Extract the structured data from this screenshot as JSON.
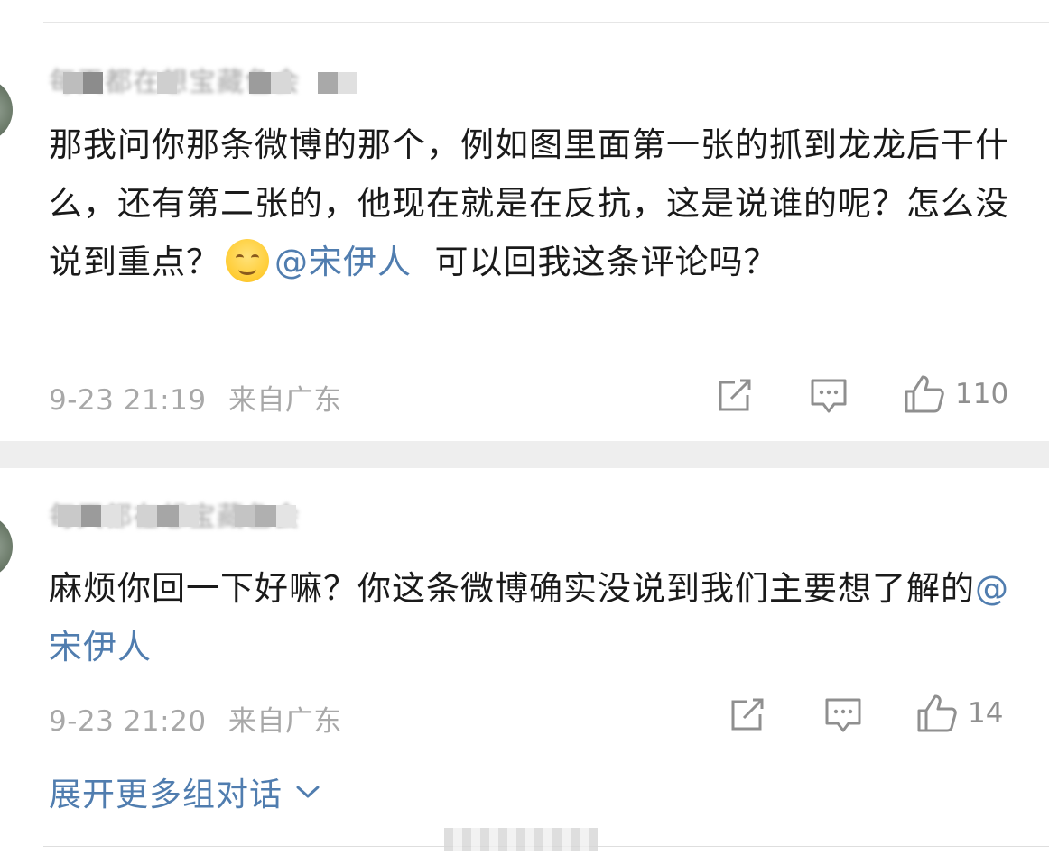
{
  "comments": [
    {
      "username": "每天都在想宝藏色会",
      "text_segments": [
        "那我问你那条微博的那个，例如图里面第一张的抓到龙龙后干什么，还有第二张的，他现在就是在反抗，这是说谁的呢？怎么没说到重点？",
        "@宋伊人",
        "  可以回我这条评论吗？"
      ],
      "date": "9-23 21:19",
      "location": "来自广东",
      "likes": "110"
    },
    {
      "username": "每天都在想宝藏色会",
      "text_segments": [
        "麻烦你回一下好嘛？你这条微博确实没说到我们主要想了解的",
        "@宋伊人"
      ],
      "date": "9-23 21:20",
      "location": "来自广东",
      "likes": "14"
    }
  ],
  "expand_label": "展开更多组对话",
  "icons": {
    "emoji": "smile-emoji-icon",
    "repost": "repost-icon",
    "comment": "comment-icon",
    "like": "thumbs-up-icon",
    "expand": "chevron-down-icon"
  },
  "colors": {
    "mention": "#507daf",
    "text": "#1a1a1a",
    "meta": "#a8a8a8"
  }
}
